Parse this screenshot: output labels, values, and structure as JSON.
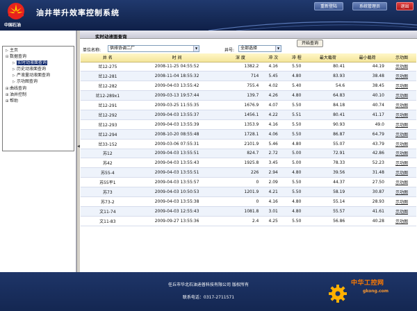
{
  "app": {
    "title": "油井举升效率控制系统",
    "logo_text": "中国石油",
    "brand_color": "#162a56"
  },
  "header_buttons": {
    "relogin": "重新登陆",
    "sysadmin": "系统管理员",
    "exit": "退出"
  },
  "sidebar": {
    "items": [
      {
        "marker": "▷",
        "label": "主页"
      },
      {
        "marker": "⊟",
        "label": "数据查询"
      },
      {
        "marker": "▷",
        "label": "实时动液面查询"
      },
      {
        "marker": "▷",
        "label": "历史动液面查询"
      },
      {
        "marker": "▷",
        "label": "严液量动液面查询"
      },
      {
        "marker": "▷",
        "label": "示功图查询"
      },
      {
        "marker": "⊞",
        "label": "曲线查询"
      },
      {
        "marker": "⊞",
        "label": "油井控制"
      },
      {
        "marker": "⊞",
        "label": "帮助"
      }
    ]
  },
  "main": {
    "title": "实时动液面查询",
    "filters": {
      "unit_label": "单位名称:",
      "unit_value": "供排协调二厂",
      "well_label": "井号:",
      "well_value": "全部选择",
      "query_button": "开始查询"
    },
    "columns": [
      "井 名",
      "时 间",
      "深 度",
      "冲 次",
      "冲 程",
      "最大载荷",
      "最小载荷",
      "示功图"
    ],
    "rows": [
      [
        "岔12-275",
        "2008-11-25 04:55:52",
        "1382.2",
        "4.16",
        "5.50",
        "80.41",
        "44.19",
        "示功图"
      ],
      [
        "岔12-281",
        "2008-11-04 18:55:32",
        "714",
        "5.45",
        "4.80",
        "83.93",
        "38.48",
        "示功图"
      ],
      [
        "岔12-282",
        "2009-04-03 13:55:42",
        "755.4",
        "4.02",
        "5.40",
        "54.6",
        "38.45",
        "示功图"
      ],
      [
        "岔12-289x1",
        "2009-03-13 19:57:44",
        "139.7",
        "4.26",
        "4.80",
        "64.83",
        "40.10",
        "示功图"
      ],
      [
        "岔12-291",
        "2009-03-25 11:55:35",
        "1676.9",
        "4.07",
        "5.50",
        "84.18",
        "40.74",
        "示功图"
      ],
      [
        "岔12-292",
        "2009-04-03 13:55:37",
        "1456.1",
        "4.22",
        "5.51",
        "80.41",
        "41.17",
        "示功图"
      ],
      [
        "岔12-293",
        "2009-04-03 13:55:39",
        "1353.9",
        "4.16",
        "5.50",
        "90.93",
        "49.0",
        "示功图"
      ],
      [
        "岔12-294",
        "2008-10-20 08:55:48",
        "1728.1",
        "4.06",
        "5.50",
        "86.87",
        "64.79",
        "示功图"
      ],
      [
        "岔33-152",
        "2009-03-06 07:55:31",
        "2101.9",
        "5.46",
        "4.80",
        "55.07",
        "43.79",
        "示功图"
      ],
      [
        "苏12",
        "2009-04-03 13:55:51",
        "824.7",
        "2.72",
        "5.00",
        "72.91",
        "42.86",
        "示功图"
      ],
      [
        "苏42",
        "2009-04-03 13:55:43",
        "1925.8",
        "3.45",
        "5.00",
        "78.33",
        "52.23",
        "示功图"
      ],
      [
        "苏55-4",
        "2009-04-03 13:55:51",
        "226",
        "2.94",
        "4.80",
        "39.56",
        "31.48",
        "示功图"
      ],
      [
        "苏55平1",
        "2009-04-03 13:55:57",
        "0",
        "2.09",
        "5.50",
        "44.37",
        "27.50",
        "示功图"
      ],
      [
        "苏73",
        "2009-04-03 10:50:53",
        "1201.9",
        "4.21",
        "5.50",
        "58.19",
        "30.87",
        "示功图"
      ],
      [
        "苏73-2",
        "2009-04-03 13:55:38",
        "0",
        "4.16",
        "4.80",
        "55.14",
        "28.93",
        "示功图"
      ],
      [
        "文11-74",
        "2009-04-03 12:55:43",
        "1081.8",
        "3.01",
        "4.80",
        "55.57",
        "41.61",
        "示功图"
      ],
      [
        "文11-83",
        "2009-09-27 13:55:36",
        "2.4",
        "4.25",
        "5.50",
        "56.86",
        "40.28",
        "示功图"
      ]
    ]
  },
  "footer": {
    "company": "任丘市华北石油迪普科技有限公司 版权所有",
    "phone": "联系电话：0317-2711571"
  },
  "watermark": {
    "text": "中华工控网",
    "url": "gkong.com"
  }
}
